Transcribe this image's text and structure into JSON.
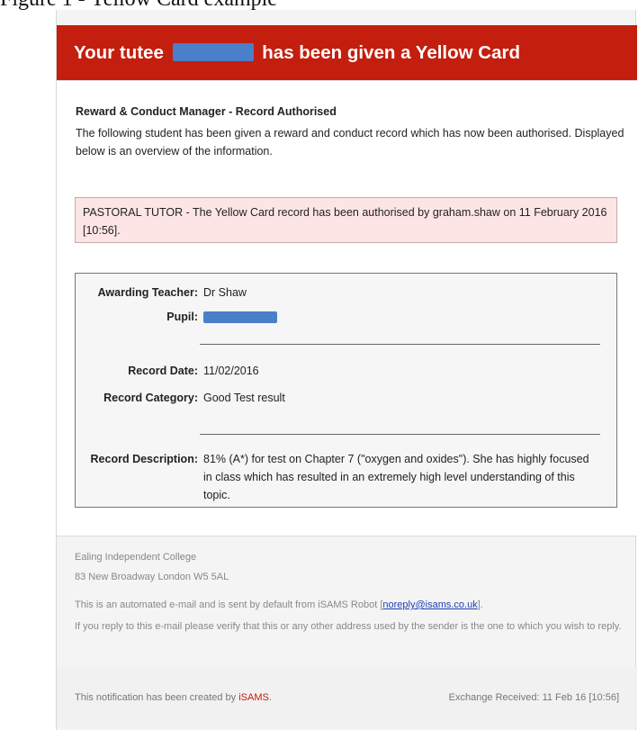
{
  "caption": "Figure 1 - Yellow Card example",
  "banner": {
    "prefix": "Your tutee",
    "suffix": "has been given a Yellow Card"
  },
  "heading": "Reward & Conduct Manager - Record Authorised",
  "intro": "The following student has been given a reward and conduct record which has now been authorised. Displayed below is an overview of the information.",
  "notice": "PASTORAL TUTOR - The Yellow Card record has been authorised by graham.shaw on 11 February 2016 [10:56].",
  "details": {
    "awarding_teacher_label": "Awarding Teacher:",
    "awarding_teacher": "Dr Shaw",
    "pupil_label": "Pupil:",
    "record_date_label": "Record Date:",
    "record_date": "11/02/2016",
    "record_category_label": "Record Category:",
    "record_category": "Good Test result",
    "record_description_label": "Record Description:",
    "record_description": "81% (A*) for test on Chapter 7 (\"oxygen and oxides\"). She has highly focused in class which has resulted in an extremely high level understanding of this topic."
  },
  "footer": {
    "school": "Ealing Independent College",
    "address": "83 New Broadway London W5 5AL",
    "automated_prefix": "This is an automated e-mail and is sent by default from iSAMS Robot [",
    "email": "noreply@isams.co.uk",
    "automated_suffix": "].",
    "reply_note": "If you reply to this e-mail please verify that this or any other address used by the sender is the one to which you wish to reply."
  },
  "bottom": {
    "created_prefix": "This notification has been created by",
    "brand": "iSAMS",
    "created_suffix": ".",
    "exchange": "Exchange Received: 11 Feb 16 [10:56]"
  },
  "colors": {
    "banner": "#c41e0e",
    "notice_bg": "#fde5e5",
    "redaction": "#4a7fc9"
  }
}
